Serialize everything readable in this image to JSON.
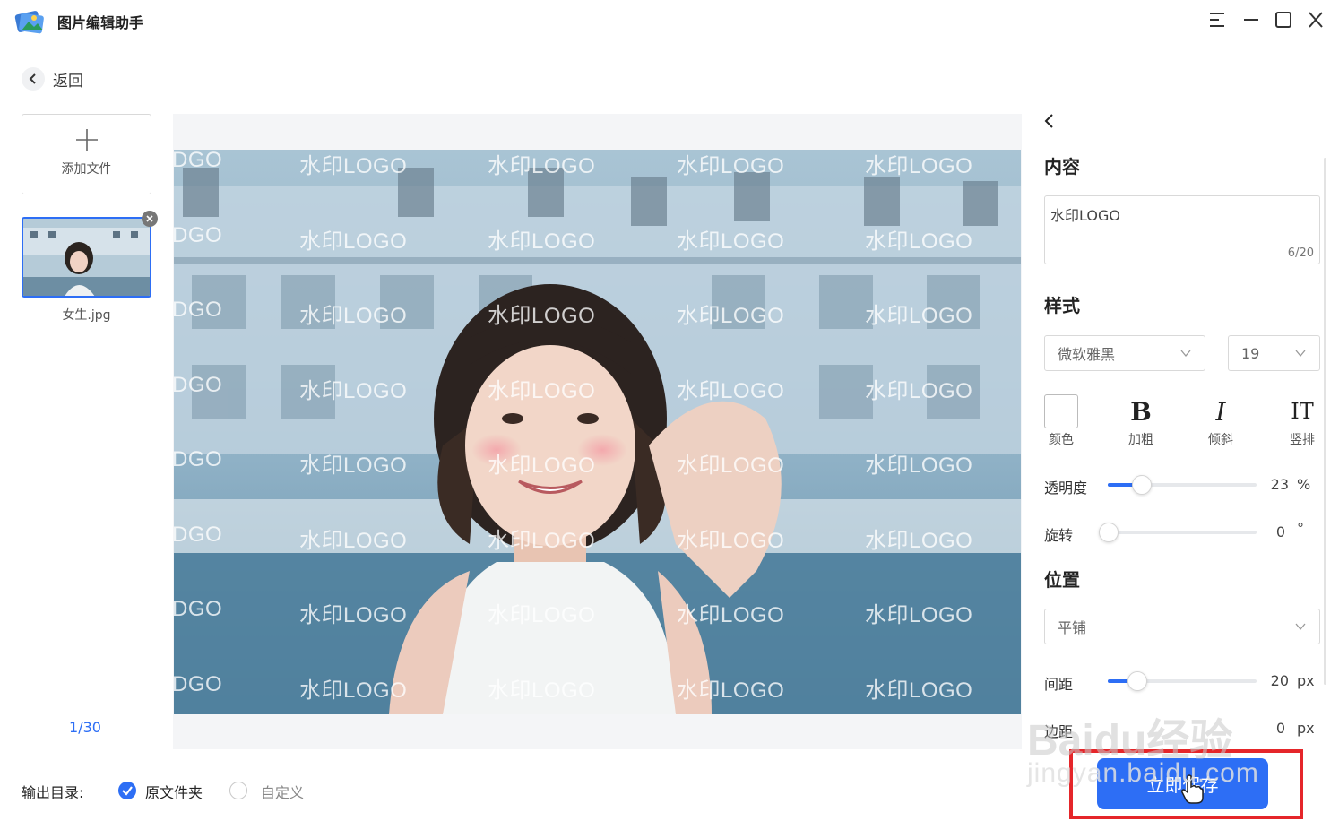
{
  "app": {
    "title": "图片编辑助手"
  },
  "nav": {
    "back_label": "返回"
  },
  "sidebar": {
    "add_file_label": "添加文件",
    "thumbnail_name": "女生.jpg",
    "pager": "1/30"
  },
  "canvas": {
    "watermark_text": "水印LOGO",
    "watermark_partial": "DGO"
  },
  "panel": {
    "content_title": "内容",
    "content_value": "水印LOGO",
    "content_count": "6/20",
    "style_title": "样式",
    "font_family": "微软雅黑",
    "font_size": "19",
    "tools": {
      "color": "颜色",
      "bold_glyph": "B",
      "bold": "加粗",
      "italic_glyph": "I",
      "italic": "倾斜",
      "vertical_glyph": "ⅠT",
      "vertical": "竖排"
    },
    "opacity_label": "透明度",
    "opacity_value": "23",
    "opacity_unit": "%",
    "rotate_label": "旋转",
    "rotate_value": "0",
    "rotate_unit": "°",
    "position_title": "位置",
    "position_mode": "平铺",
    "spacing_label": "间距",
    "spacing_value": "20",
    "spacing_unit": "px",
    "margin_label": "边距",
    "margin_value": "0",
    "margin_unit": "px"
  },
  "save_button_label": "立即保存",
  "output": {
    "label": "输出目录:",
    "option_original": "原文件夹",
    "option_custom": "自定义"
  },
  "overlay_watermark": {
    "brand": "Baidu经验",
    "url": "jingyan.baidu.com"
  },
  "colors": {
    "accent": "#2d6ef5",
    "highlight": "#e5262a"
  }
}
